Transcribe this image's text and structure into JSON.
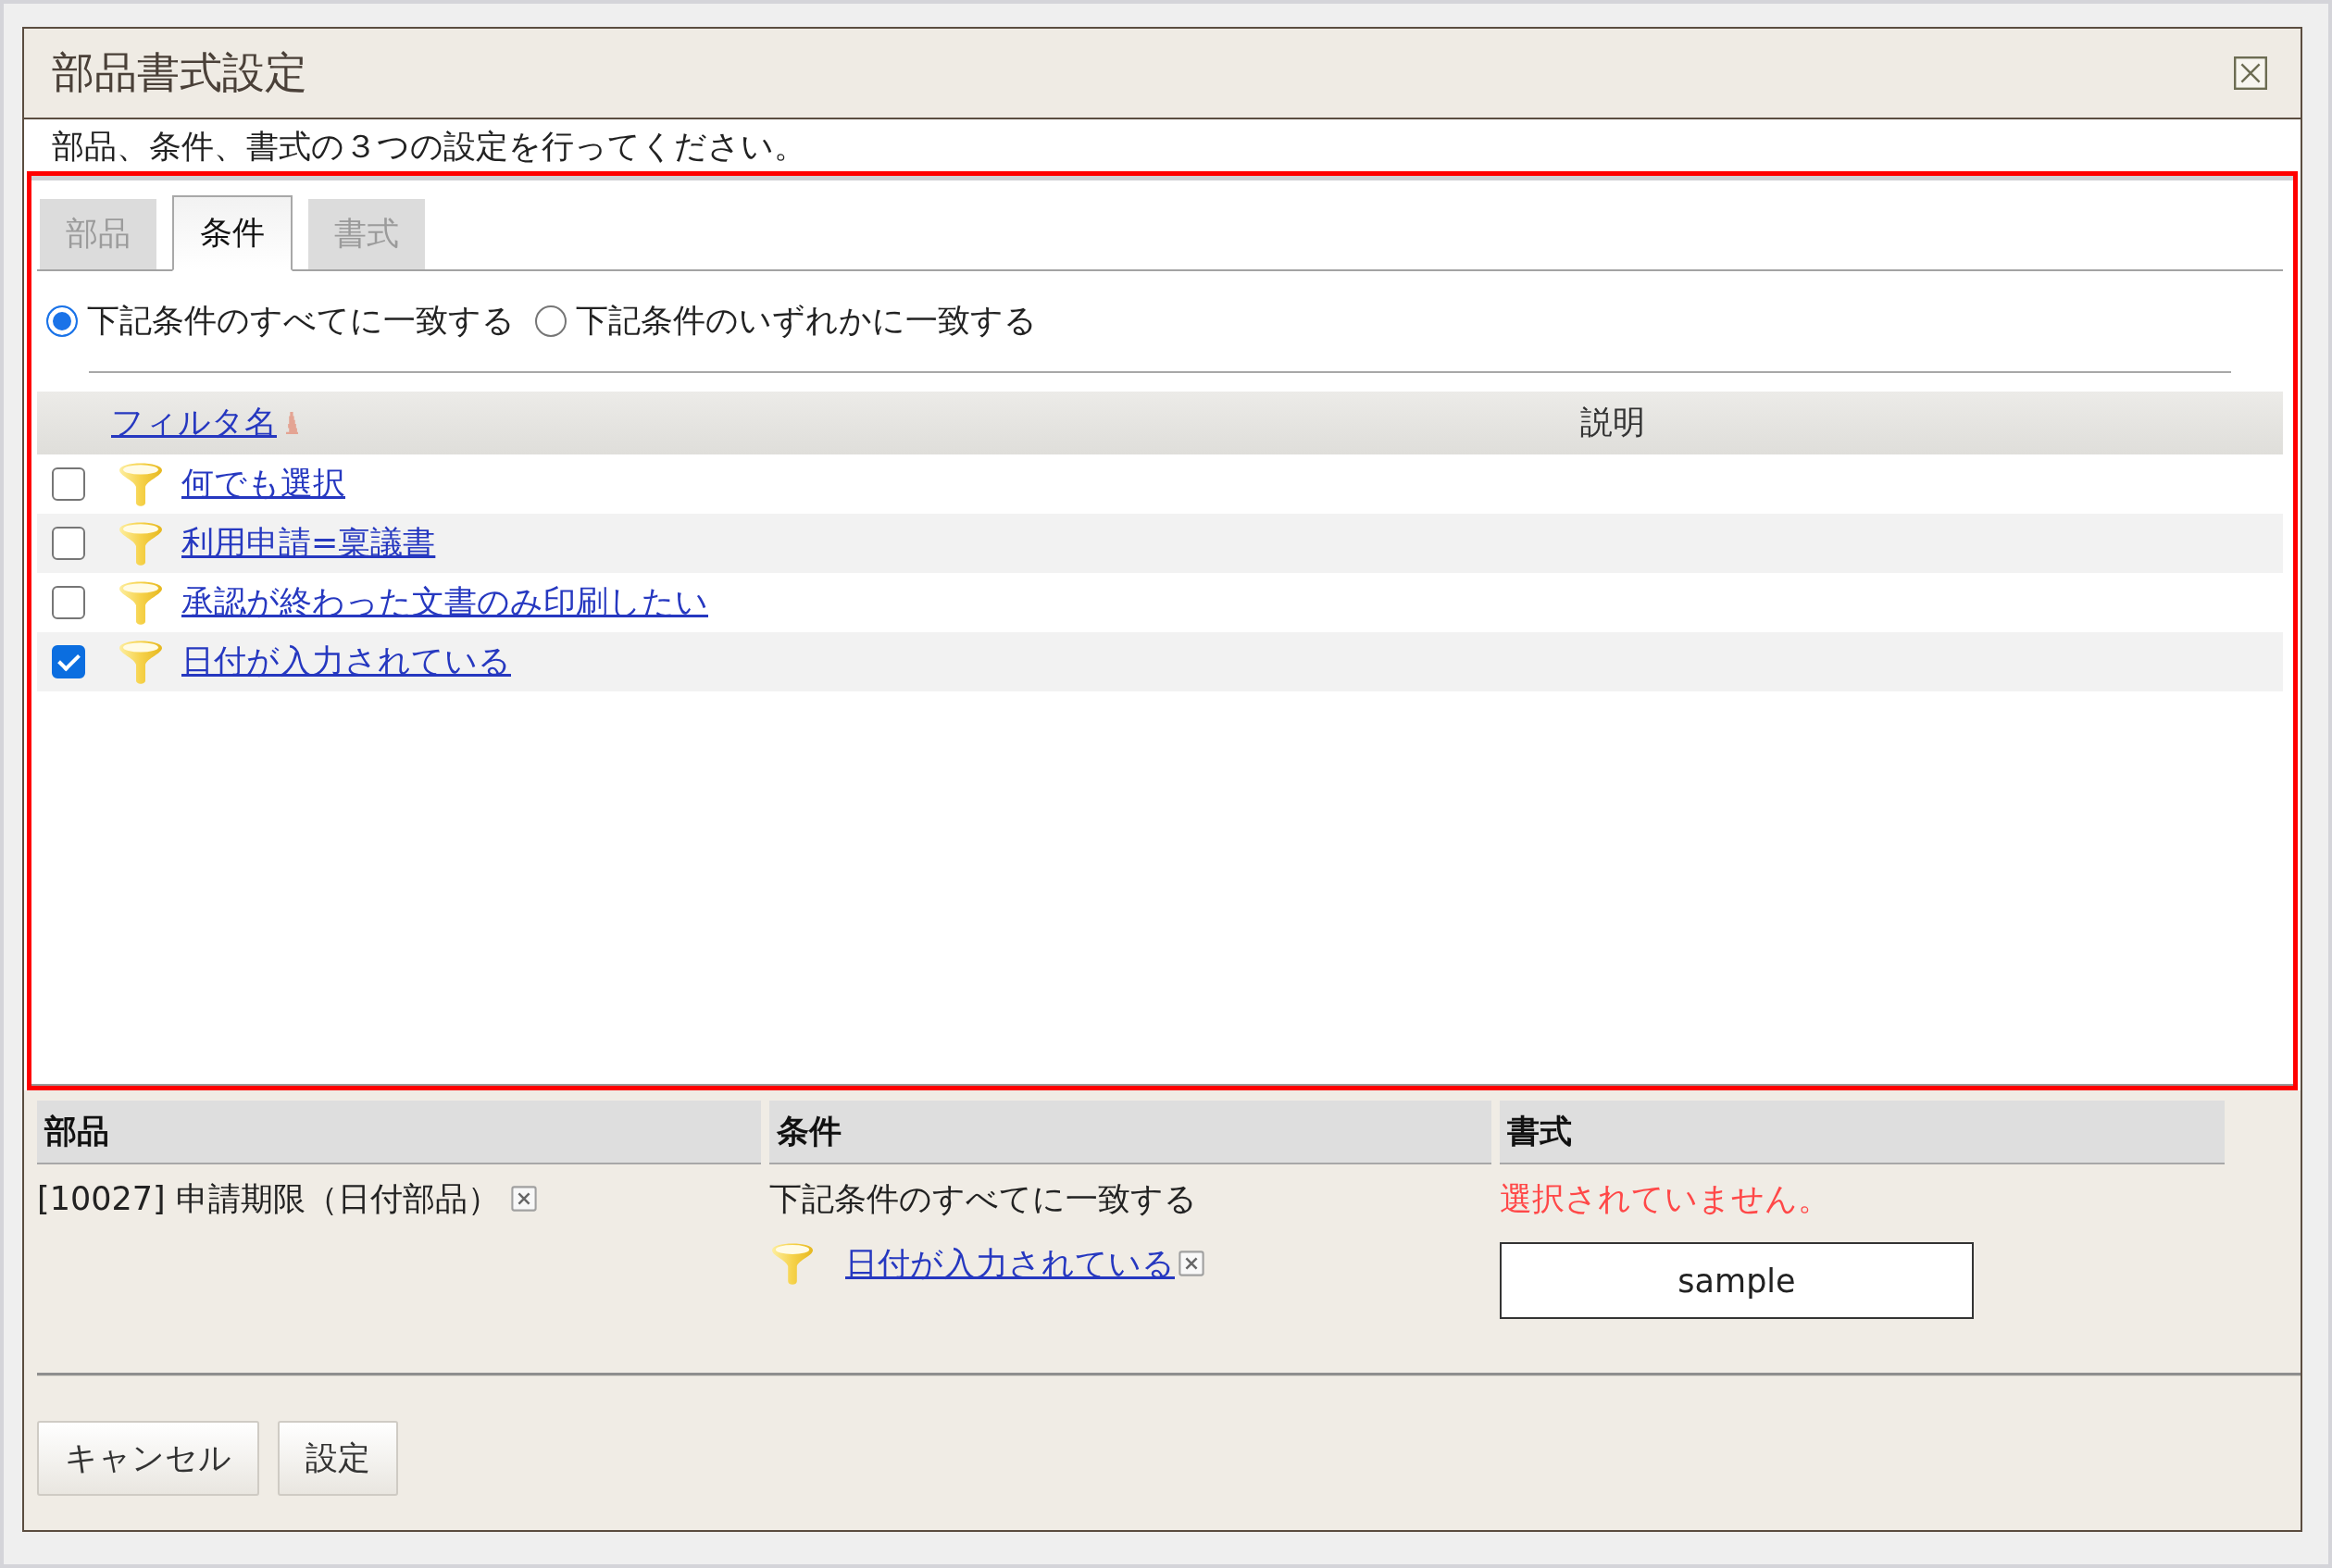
{
  "dialog": {
    "title": "部品書式設定",
    "instruction": "部品、条件、書式の３つの設定を行ってください。"
  },
  "condition_panel": {
    "highlighted": true,
    "tabs": [
      {
        "label": "部品",
        "selected": false
      },
      {
        "label": "条件",
        "selected": true
      },
      {
        "label": "書式",
        "selected": false
      }
    ],
    "match_options": [
      {
        "label": "下記条件のすべてに一致する",
        "selected": true
      },
      {
        "label": "下記条件のいずれかに一致する",
        "selected": false
      }
    ],
    "table": {
      "columns": [
        {
          "label": "フィルタ名",
          "sorted": true
        },
        {
          "label": "説明"
        }
      ],
      "rows": [
        {
          "name": "何でも選択",
          "checked": false
        },
        {
          "name": "利用申請=稟議書",
          "checked": false
        },
        {
          "name": "承認が終わった文書のみ印刷したい",
          "checked": false
        },
        {
          "name": "日付が入力されている",
          "checked": true
        }
      ]
    }
  },
  "summary": [
    {
      "kind": "part",
      "heading": "部品",
      "items": [
        "[10027] 申請期限（日付部品）"
      ]
    },
    {
      "kind": "condition",
      "heading": "条件",
      "match": "下記条件のすべてに一致する",
      "filters": [
        "日付が入力されている"
      ]
    },
    {
      "kind": "format",
      "heading": "書式",
      "message": "選択されていません。",
      "preview": "sample"
    }
  ],
  "buttons": [
    {
      "label": "キャンセル"
    },
    {
      "label": "設定"
    }
  ]
}
